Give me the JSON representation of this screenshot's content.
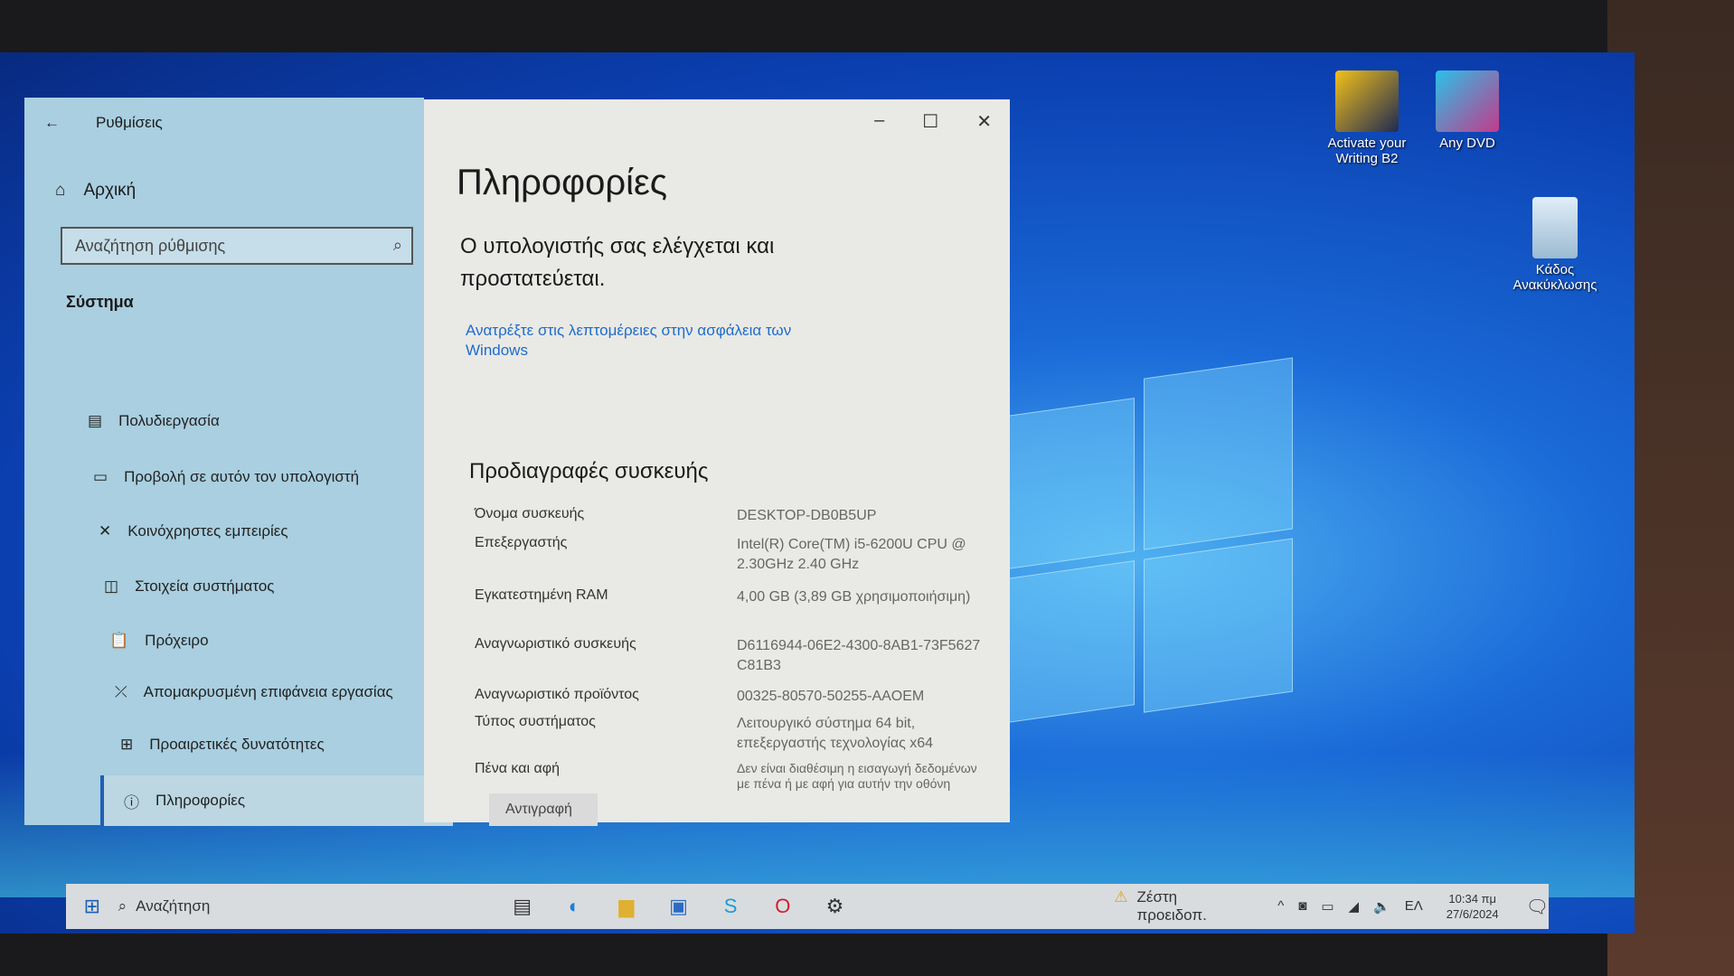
{
  "settings": {
    "title": "Ρυθμίσεις",
    "home": "Αρχική",
    "search_placeholder": "Αναζήτηση ρύθμισης",
    "section": "Σύστημα",
    "nav": [
      {
        "label": "Πολυδιεργασία"
      },
      {
        "label": "Προβολή σε αυτόν τον υπολογιστή"
      },
      {
        "label": "Κοινόχρηστες εμπειρίες"
      },
      {
        "label": "Στοιχεία συστήματος"
      },
      {
        "label": "Πρόχειρο"
      },
      {
        "label": "Απομακρυσμένη επιφάνεια εργασίας"
      },
      {
        "label": "Προαιρετικές δυνατότητες"
      },
      {
        "label": "Πληροφορίες"
      }
    ]
  },
  "content": {
    "title": "Πληροφορίες",
    "protection": "Ο υπολογιστής σας ελέγχεται και προστατεύεται.",
    "security_link": "Ανατρέξτε στις λεπτομέρειες στην ασφάλεια των Windows",
    "specs_title": "Προδιαγραφές συσκευής",
    "specs": [
      {
        "k": "Όνομα συσκευής",
        "v": "DESKTOP-DB0B5UP"
      },
      {
        "k": "Επεξεργαστής",
        "v": "Intel(R) Core(TM) i5-6200U CPU @ 2.30GHz   2.40 GHz"
      },
      {
        "k": "Εγκατεστημένη RAM",
        "v": "4,00 GB (3,89 GB χρησιμοποιήσιμη)"
      },
      {
        "k": "Αναγνωριστικό συσκευής",
        "v": "D6116944-06E2-4300-8AB1-73F5627C81B3"
      },
      {
        "k": "Αναγνωριστικό προϊόντος",
        "v": "00325-80570-50255-AAOEM"
      },
      {
        "k": "Τύπος συστήματος",
        "v": "Λειτουργικό σύστημα 64 bit, επεξεργαστής τεχνολογίας x64"
      },
      {
        "k": "Πένα και αφή",
        "v": "Δεν είναι διαθέσιμη η εισαγωγή δεδομένων με πένα ή με αφή για αυτήν την οθόνη"
      }
    ],
    "copy": "Αντιγραφή"
  },
  "desktop": [
    {
      "label": "Activate your Writing B2"
    },
    {
      "label": "Any DVD"
    },
    {
      "label": "Κάδος Ανακύκλωσης"
    }
  ],
  "taskbar": {
    "search": "Αναζήτηση",
    "weather": "Ζέστη προειδοπ.",
    "lang": "ΕΛ",
    "time": "10:34 πμ",
    "date": "27/6/2024"
  }
}
